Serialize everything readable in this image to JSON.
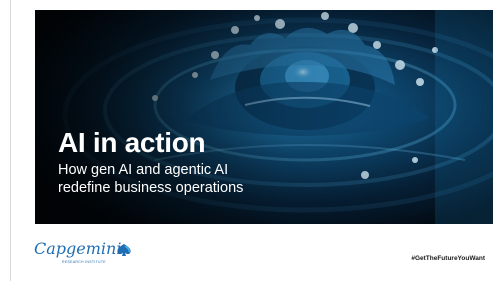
{
  "slide": {
    "title": "AI in action",
    "subtitle_line1": "How gen AI and agentic AI",
    "subtitle_line2": "redefine business operations"
  },
  "footer": {
    "brand": "Capgemini",
    "brand_sub": "RESEARCH INSTITUTE",
    "hashtag": "#GetTheFutureYouWant"
  },
  "colors": {
    "brand_blue": "#1f6db3",
    "hero_dark": "#04121f",
    "water_blue": "#1e7fb8"
  }
}
